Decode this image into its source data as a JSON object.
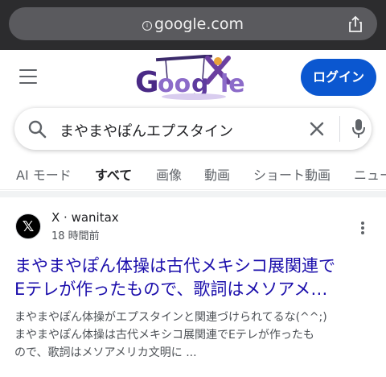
{
  "browser": {
    "url": "google.com",
    "icons": [
      "info-icon",
      "share-icon"
    ]
  },
  "header": {
    "login_label": "ログイン",
    "doodle_text": "Google",
    "icons": [
      "menu-icon"
    ]
  },
  "search": {
    "query": "まやまやぽんエプスタイン",
    "icons": [
      "search-icon",
      "clear-icon",
      "mic-icon"
    ]
  },
  "tabs": [
    {
      "label": "AI モード"
    },
    {
      "label": "すべて"
    },
    {
      "label": "画像"
    },
    {
      "label": "動画"
    },
    {
      "label": "ショート動画"
    },
    {
      "label": "ニュー"
    }
  ],
  "active_tab": "すべて",
  "result": {
    "favicon_glyph": "𝕏",
    "site": "X · wanitax",
    "time": "18 時間前",
    "title_line1": "まやまやぽん体操は古代メキシコ展関連で",
    "title_line2": "Eテレが作ったもので、歌詞はメソアメ…",
    "snippet_line1": "まやまやぽん体操がエプスタインと関連づけられてるな(^^;)",
    "snippet_line2": "まやまやぽん体操は古代メキシコ展関連でEテレが作ったも",
    "snippet_line3": "ので、歌詞はメソアメリカ文明に ..."
  },
  "colors": {
    "login_bg": "#0b57d0",
    "link": "#1a0dab",
    "browser_bar": "#2c2c2e"
  }
}
